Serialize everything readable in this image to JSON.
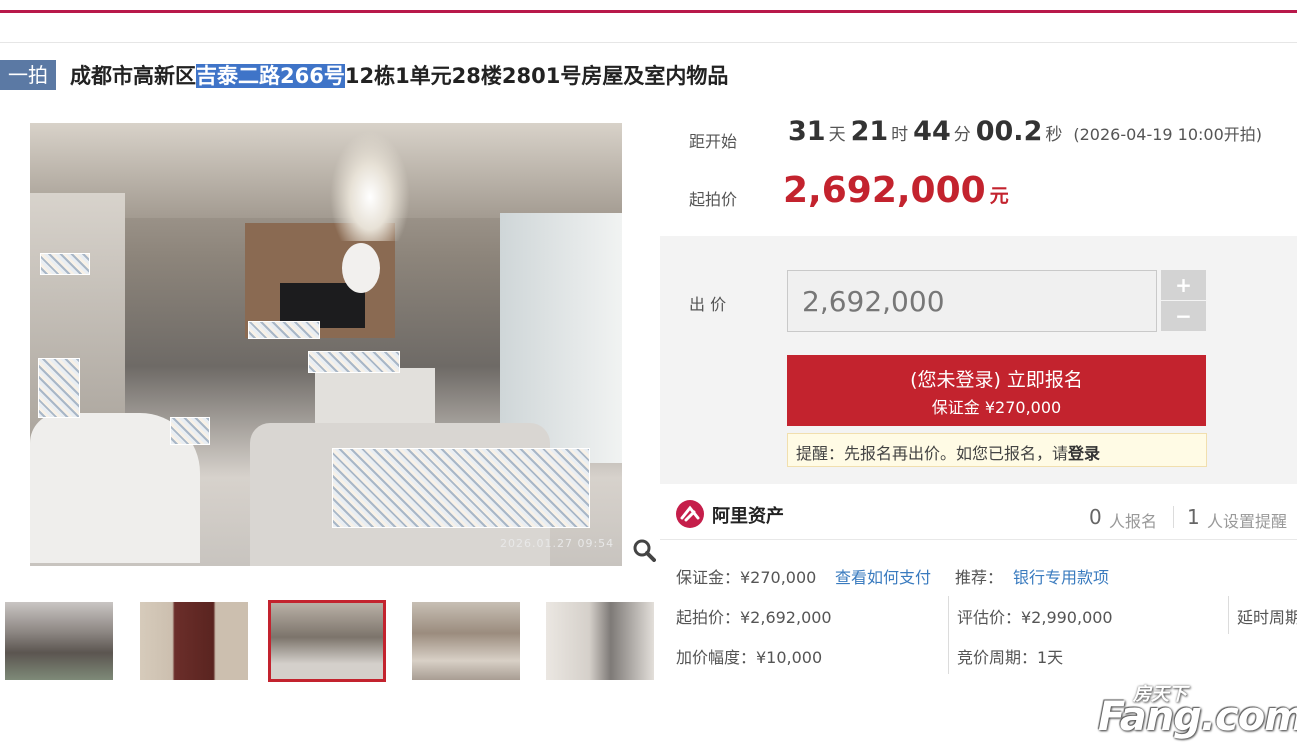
{
  "title": {
    "tag": "一拍",
    "prefix": "成都市高新区",
    "highlight": "吉泰二路266号",
    "suffix": "12栋1单元28楼2801号房屋及室内物品"
  },
  "image": {
    "timestamp": "2026.01.27 09:54"
  },
  "countdown": {
    "label": "距开始",
    "days": "31",
    "days_unit": "天",
    "hours": "21",
    "hours_unit": "时",
    "minutes": "44",
    "minutes_unit": "分",
    "seconds": "00.2",
    "seconds_unit": "秒",
    "start_text": "(2026-04-19 10:00开拍)"
  },
  "starting_price": {
    "label": "起拍价",
    "value": "2,692,000",
    "unit": "元"
  },
  "bid": {
    "label": "出 价",
    "value": "2,692,000",
    "plus": "+",
    "minus": "−"
  },
  "signup_button": {
    "line1": "(您未登录) 立即报名",
    "line2": "保证金 ¥270,000"
  },
  "tip": {
    "text": "提醒：先报名再出价。如您已报名，请",
    "login": "登录"
  },
  "platform": {
    "name": "阿里资产",
    "signups": "0",
    "signups_label": "人报名",
    "reminders": "1",
    "reminders_label": "人设置提醒"
  },
  "details": {
    "deposit": "保证金：¥270,000",
    "how_to_pay": "查看如何支付",
    "recommend_label": "推荐：",
    "recommend_link": "银行专用款项",
    "starting": "起拍价：¥2,692,000",
    "appraisal": "评估价：¥2,990,000",
    "delay": "延时周期",
    "increment": "加价幅度：¥10,000",
    "bidding_cycle": "竞价周期：1天"
  },
  "watermark": {
    "top": "房天下",
    "main": "Fang.com"
  },
  "colors": {
    "accent": "#c3232e",
    "tag": "#5b79a4",
    "link": "#3a7bbf"
  }
}
